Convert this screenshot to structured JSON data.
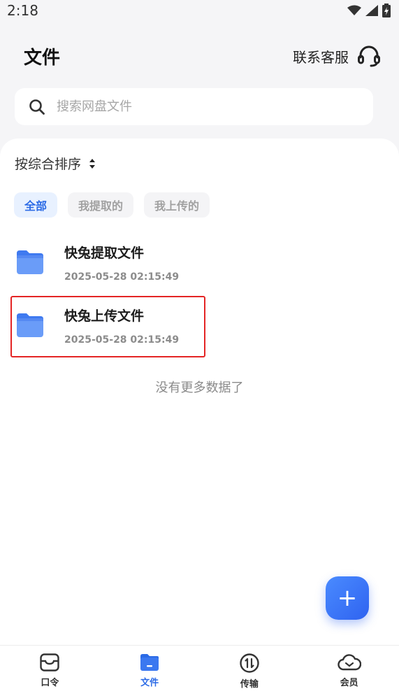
{
  "status_bar": {
    "time": "2:18"
  },
  "header": {
    "title": "文件",
    "support_label": "联系客服",
    "support_icon": "headset-icon"
  },
  "search": {
    "placeholder": "搜索网盘文件",
    "icon": "search-icon"
  },
  "sort": {
    "label": "按综合排序",
    "icon": "sort-arrows-icon"
  },
  "filters": [
    {
      "label": "全部",
      "active": true
    },
    {
      "label": "我提取的",
      "active": false
    },
    {
      "label": "我上传的",
      "active": false
    }
  ],
  "files": [
    {
      "name": "快兔提取文件",
      "date": "2025-05-28 02:15:49",
      "icon": "folder-icon"
    },
    {
      "name": "快兔上传文件",
      "date": "2025-05-28 02:15:49",
      "icon": "folder-icon"
    }
  ],
  "list_footer": "没有更多数据了",
  "fab": {
    "label": "+",
    "color": "#3b74f5"
  },
  "tabs": [
    {
      "label": "口令",
      "icon": "inbox-icon",
      "active": false
    },
    {
      "label": "文件",
      "icon": "folder-tab-icon",
      "active": true
    },
    {
      "label": "传输",
      "icon": "transfer-icon",
      "active": false
    },
    {
      "label": "会员",
      "icon": "cloud-icon",
      "active": false
    }
  ],
  "colors": {
    "accent": "#2c6be6",
    "highlight": "#e42525",
    "background": "#f5f5f7"
  }
}
